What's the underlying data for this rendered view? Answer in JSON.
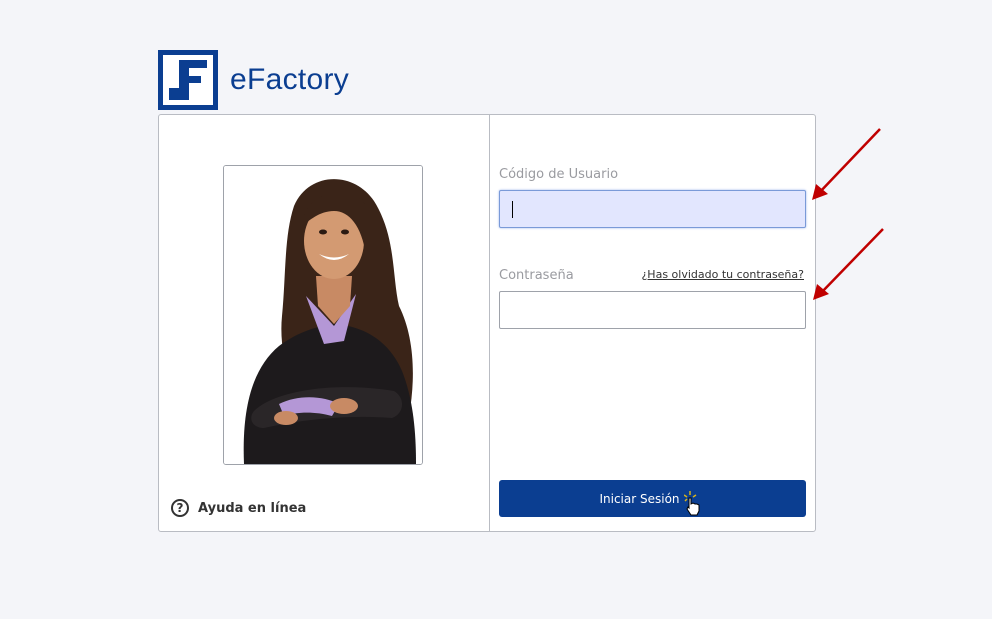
{
  "brand": {
    "name": "eFactory",
    "color": "#0b3e91"
  },
  "login": {
    "user_label": "Código de Usuario",
    "user_value": "",
    "password_label": "Contraseña",
    "password_value": "",
    "forgot_link": "¿Has olvidado tu contraseña?",
    "submit_label": "Iniciar Sesión"
  },
  "help": {
    "label": "Ayuda en línea",
    "icon": "question-circle-icon"
  },
  "annotations": {
    "arrow_color": "#c00000",
    "count": 2
  },
  "colors": {
    "primary": "#0b3e91",
    "background": "#f4f5f9",
    "focused_input": "#e2e6fe"
  }
}
